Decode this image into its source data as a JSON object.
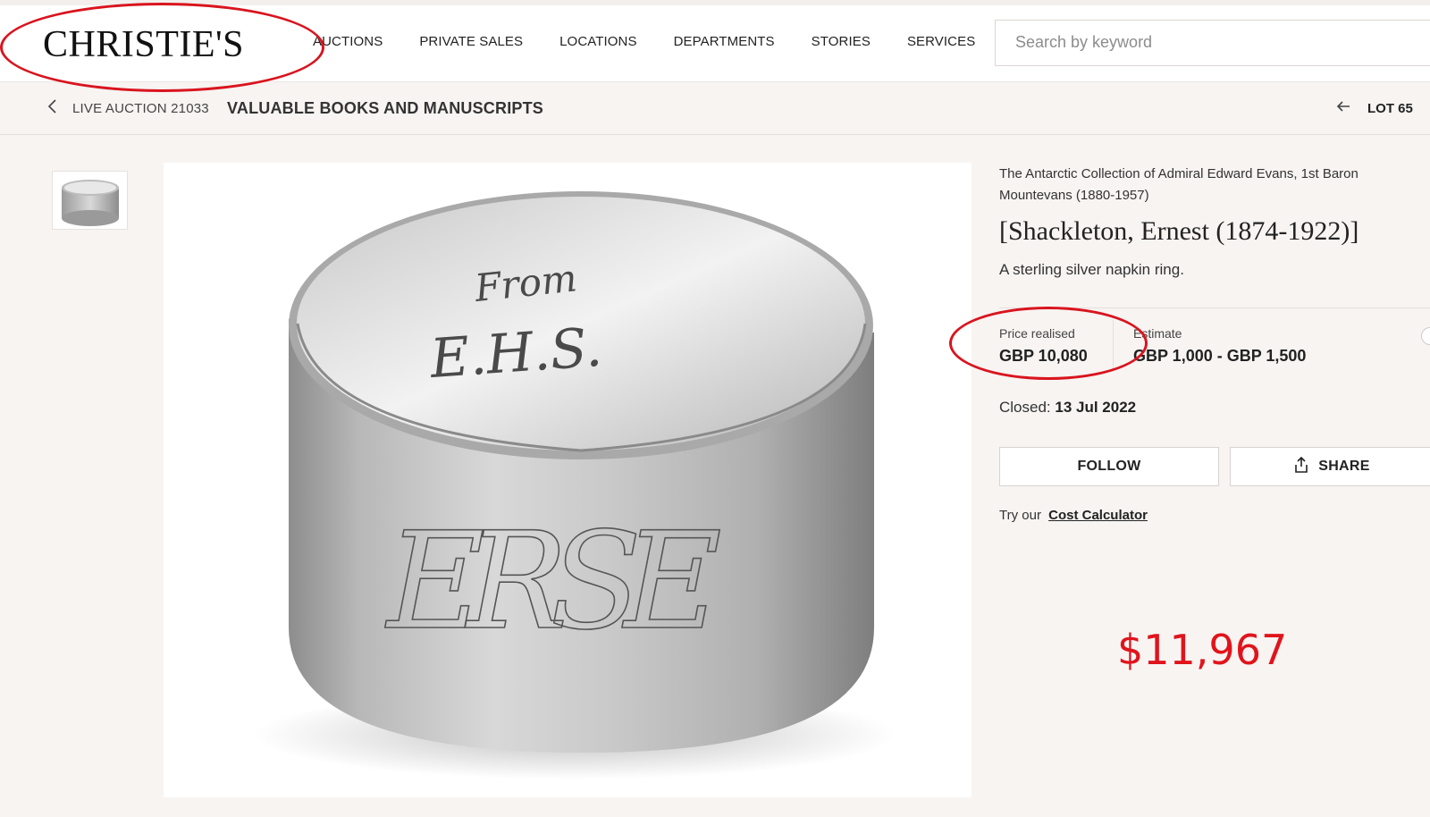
{
  "header": {
    "logo": "CHRISTIE'S",
    "nav": [
      "AUCTIONS",
      "PRIVATE SALES",
      "LOCATIONS",
      "DEPARTMENTS",
      "STORIES",
      "SERVICES"
    ],
    "search_placeholder": "Search by keyword"
  },
  "breadcrumb": {
    "back_icon": "chevron-left-icon",
    "auction": "LIVE AUCTION 21033",
    "title": "VALUABLE BOOKS AND MANUSCRIPTS",
    "lot_arrow_icon": "arrow-left-icon",
    "lot": "LOT 65"
  },
  "lot": {
    "collection": "The Antarctic Collection of Admiral Edward Evans, 1st Baron Mountevans (1880-1957)",
    "title": "[Shackleton, Ernest (1874-1922)]",
    "description": "A sterling silver napkin ring.",
    "price_label": "Price realised",
    "price_value": "GBP 10,080",
    "estimate_label": "Estimate",
    "estimate_value": "GBP 1,000 - GBP 1,500",
    "closed_label": "Closed:",
    "closed_date": "13 Jul 2022",
    "follow_label": "FOLLOW",
    "share_label": "SHARE",
    "calc_prefix": "Try our",
    "calc_link": "Cost Calculator"
  },
  "image": {
    "engraving_inner_1": "From",
    "engraving_inner_2": "E.H.S.",
    "engraving_outer": "ERSE"
  },
  "annotation": {
    "usd_price": "$11,967",
    "color": "#d9141e"
  }
}
